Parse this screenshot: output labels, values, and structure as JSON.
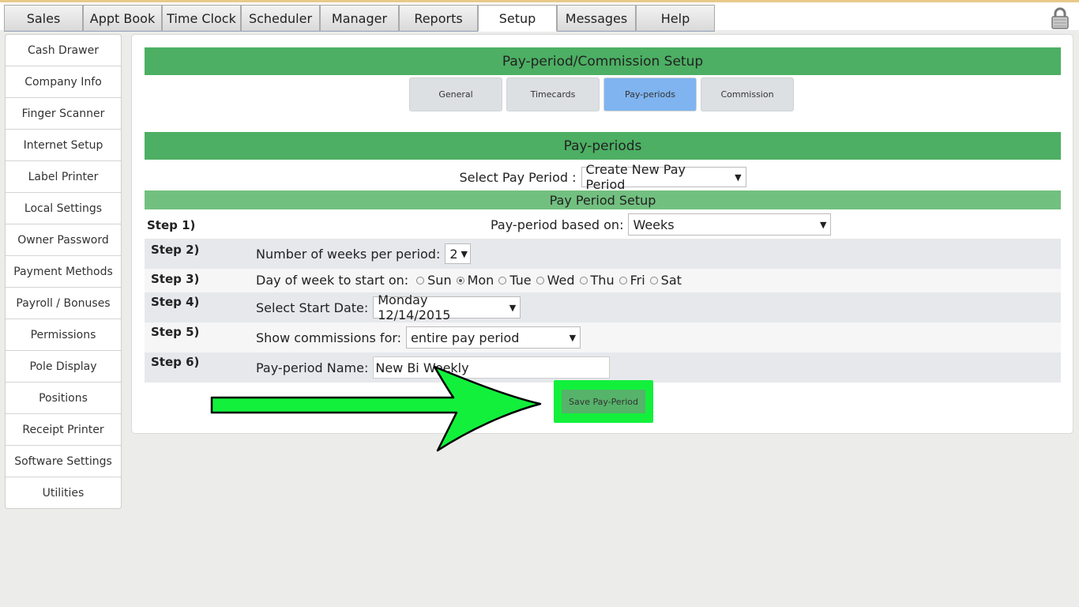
{
  "top_tabs": [
    "Sales",
    "Appt Book",
    "Time Clock",
    "Scheduler",
    "Manager",
    "Reports",
    "Setup",
    "Messages",
    "Help"
  ],
  "active_tab": "Setup",
  "sidebar": [
    "Cash Drawer",
    "Company Info",
    "Finger Scanner",
    "Internet Setup",
    "Label Printer",
    "Local Settings",
    "Owner Password",
    "Payment Methods",
    "Payroll / Bonuses",
    "Permissions",
    "Pole Display",
    "Positions",
    "Receipt Printer",
    "Software Settings",
    "Utilities"
  ],
  "panel": {
    "title": "Pay-period/Commission Setup",
    "subtabs": [
      "General",
      "Timecards",
      "Pay-periods",
      "Commission"
    ],
    "active_subtab": "Pay-periods",
    "section_title": "Pay-periods",
    "select_label": "Select Pay Period :",
    "select_value": "Create New Pay Period",
    "setup_title": "Pay Period Setup",
    "steps": {
      "s1": {
        "step": "Step 1)",
        "label": "Pay-period based on:",
        "value": "Weeks"
      },
      "s2": {
        "step": "Step 2)",
        "label": "Number of weeks per period:",
        "value": "2"
      },
      "s3": {
        "step": "Step 3)",
        "label": "Day of week to start on:",
        "days": [
          "Sun",
          "Mon",
          "Tue",
          "Wed",
          "Thu",
          "Fri",
          "Sat"
        ],
        "selected": "Mon"
      },
      "s4": {
        "step": "Step 4)",
        "label": "Select Start Date:",
        "value": "Monday 12/14/2015"
      },
      "s5": {
        "step": "Step 5)",
        "label": "Show commissions for:",
        "value": "entire pay period"
      },
      "s6": {
        "step": "Step 6)",
        "label": "Pay-period Name:",
        "value": "New Bi Weekly"
      }
    },
    "save_label": "Save Pay-Period"
  },
  "colors": {
    "header_green": "#4caf63",
    "highlight_green": "#12f03c",
    "active_subtab": "#7fb4f0"
  }
}
